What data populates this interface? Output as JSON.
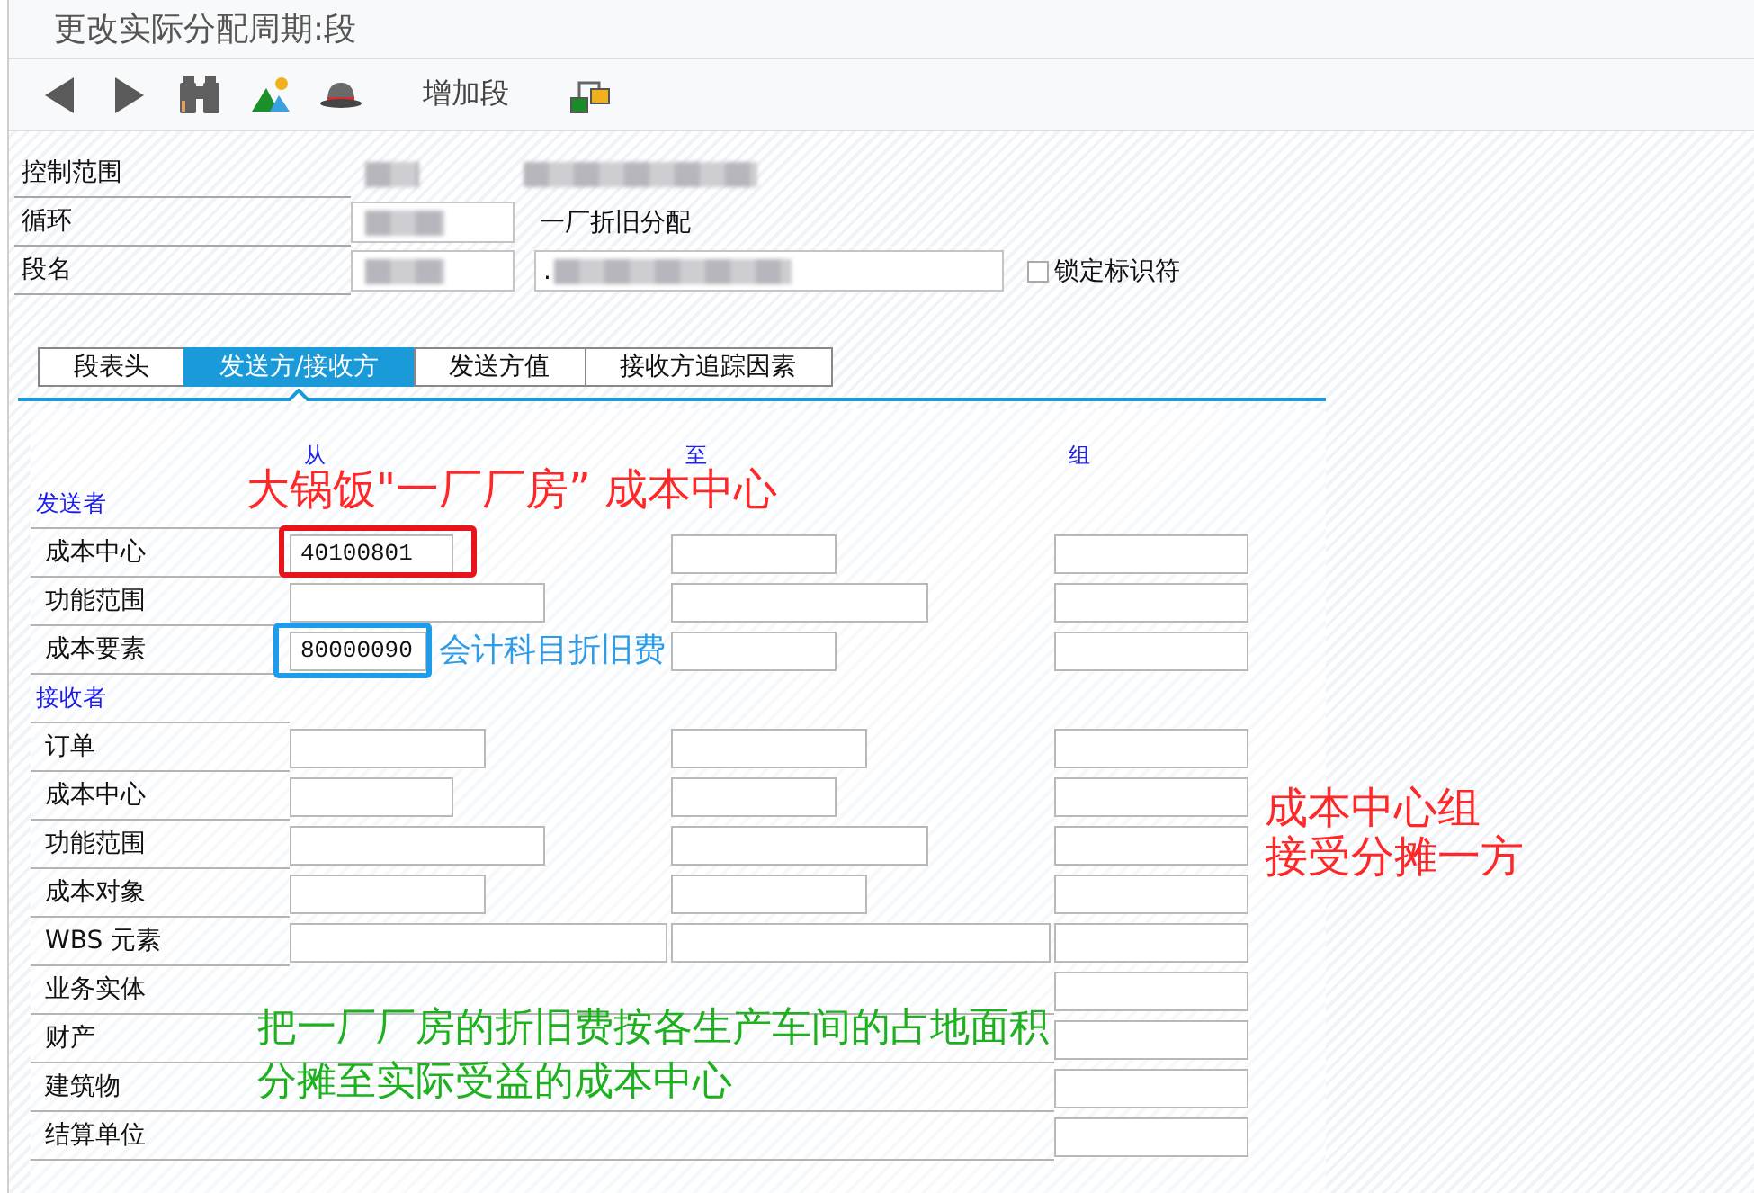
{
  "window": {
    "title": "更改实际分配周期:段"
  },
  "toolbar": {
    "text_button": "增加段"
  },
  "header": [
    {
      "label": "控制范围",
      "kind": "display",
      "redacted": true
    },
    {
      "label": "循环",
      "kind": "input",
      "redacted": true,
      "description": "一厂折旧分配"
    },
    {
      "label": "段名",
      "kind": "input",
      "redacted": true,
      "text_field": {
        "value": ".",
        "redacted": true
      },
      "checkbox": {
        "label": "锁定标识符",
        "checked": false
      }
    }
  ],
  "tabs": [
    {
      "label": "段表头",
      "selected": false
    },
    {
      "label": "发送方/接收方",
      "selected": true
    },
    {
      "label": "发送方值",
      "selected": false
    },
    {
      "label": "接收方追踪因素",
      "selected": false
    }
  ],
  "columns": [
    "从",
    "至",
    "组"
  ],
  "sections": [
    {
      "title": "发送者",
      "rows": [
        {
          "label": "成本中心",
          "range_fields": true,
          "from": "40100801",
          "highlight": {
            "color": "#e8141c"
          }
        },
        {
          "label": "功能范围",
          "range_fields": true
        },
        {
          "label": "成本要素",
          "range_fields": true,
          "from": "80000090",
          "highlight": {
            "color": "#1e9be9"
          }
        }
      ]
    },
    {
      "title": "接收者",
      "rows": [
        {
          "label": "订单",
          "range_fields": true
        },
        {
          "label": "成本中心",
          "range_fields": true
        },
        {
          "label": "功能范围",
          "range_fields": true
        },
        {
          "label": "成本对象",
          "range_fields": true
        },
        {
          "label": "WBS 元素",
          "range_fields": true
        },
        {
          "label": "业务实体",
          "range_fields": false
        },
        {
          "label": "财产",
          "range_fields": false
        },
        {
          "label": "建筑物",
          "range_fields": false
        },
        {
          "label": "结算单位",
          "range_fields": false
        }
      ]
    }
  ],
  "annotations": [
    {
      "text": "大锅饭\"一厂厂房” 成本中心",
      "color": "#ff2828"
    },
    {
      "text": "会计科目折旧费",
      "color": "#2e9be6"
    },
    {
      "text": "成本中心组",
      "color": "#ff2828"
    },
    {
      "text": "接受分摊一方",
      "color": "#ff2828"
    },
    {
      "text": "把一厂厂房的折旧费按各生产车间的占地面积",
      "color": "#1fb01f"
    },
    {
      "text": "分摊至实际受益的成本中心",
      "color": "#1fb01f"
    }
  ]
}
